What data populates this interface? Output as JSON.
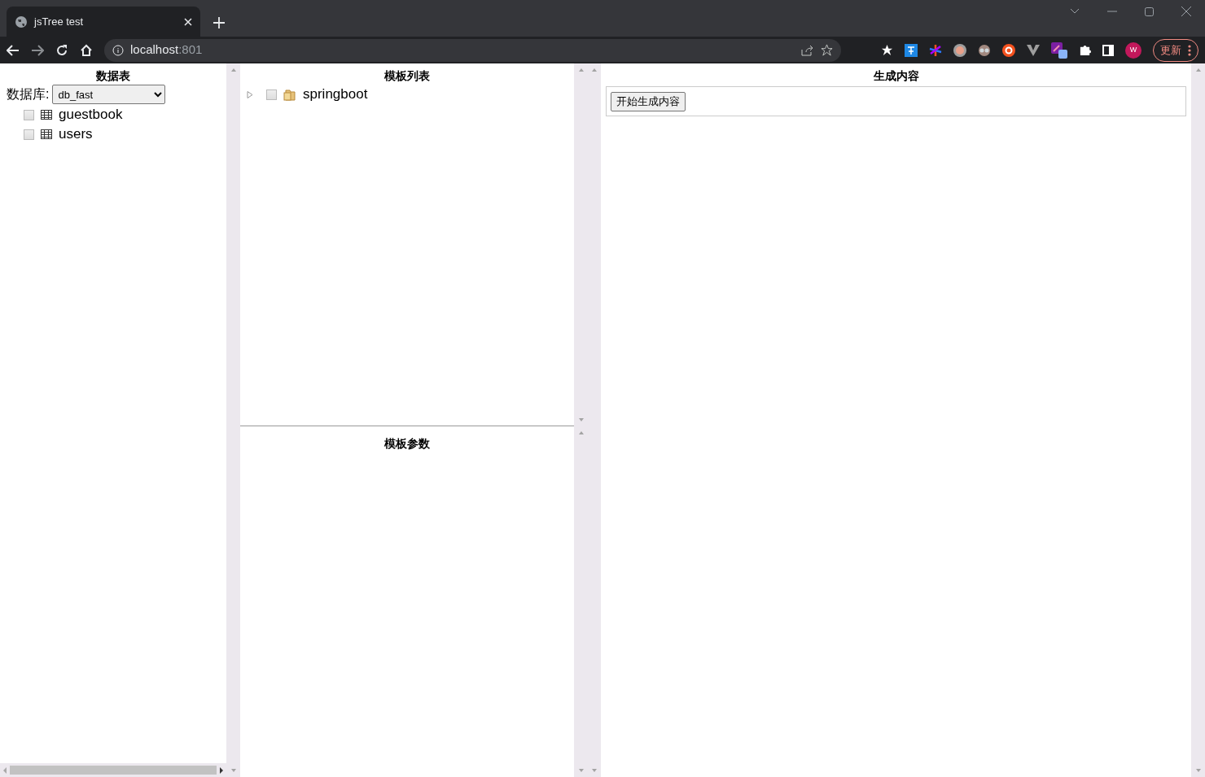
{
  "browser": {
    "tab_title": "jsTree test",
    "url_host": "localhost",
    "url_port": ":801",
    "update_button": "更新",
    "profile_initial": "W"
  },
  "tables_panel": {
    "title": "数据表",
    "database_label": "数据库:",
    "database_value": "db_fast",
    "items": [
      {
        "label": "guestbook",
        "checked": false
      },
      {
        "label": "users",
        "checked": false
      }
    ]
  },
  "template_panel": {
    "title": "模板列表",
    "items": [
      {
        "label": "springboot",
        "checked": false,
        "expanded": false
      }
    ]
  },
  "params_panel": {
    "title": "模板参数"
  },
  "output_panel": {
    "title": "生成内容",
    "button": "开始生成内容"
  }
}
